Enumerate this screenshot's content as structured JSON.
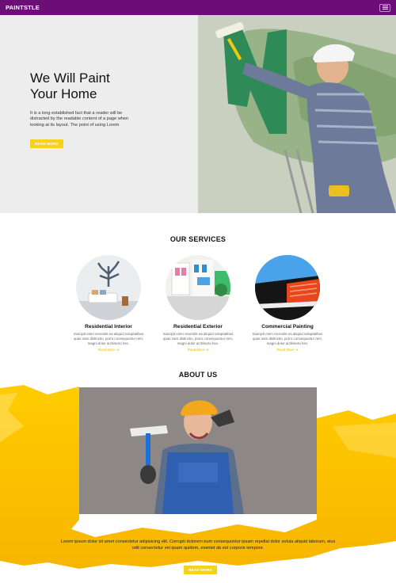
{
  "nav": {
    "brand": "PAINTSTLE",
    "menu_icon": "hamburger-icon"
  },
  "hero": {
    "title_line1": "We Will Paint",
    "title_line2": "Your Home",
    "description": "It is a long established fact that a reader will be distracted by the readable content of a page when looking at its layout. The point of using Lorem",
    "button_label": "READ MORE"
  },
  "services": {
    "heading": "OUR SERVICES",
    "items": [
      {
        "title": "Residential Interior",
        "description": "Suscipit enim recendis ea aliquid voluptatibus quas nam distinctio, porro consequuntur rem, magni dolor architecto hec.",
        "link": "Read More ➜"
      },
      {
        "title": "Residential Exterior",
        "description": "Suscipit enim recendis ea aliquid voluptatibus quas nam distinctio, porro consequuntur rem, magni dolor architecto hec.",
        "link": "Read More ➜"
      },
      {
        "title": "Commercial Painting",
        "description": "Suscipit enim recendis ea aliquid voluptatibus quas nam distinctio, porro consequuntur rem, magni dolor architecto hec.",
        "link": "Read More ➜"
      }
    ]
  },
  "about": {
    "heading": "ABOUT US",
    "text": "Lorem ipsum dolor sit amet consectetur adipisicing elit. Corrupti dolorem eum consequuntur ipsam repellat dolor soluta aliquid laborum, eius odit consectetur vel quam quidem, eveniet ab est corporis tempore.",
    "button_label": "READ MORE"
  },
  "colors": {
    "nav_bg": "#6b0f77",
    "accent": "#f6d21a",
    "hero_bg": "#ededed"
  }
}
